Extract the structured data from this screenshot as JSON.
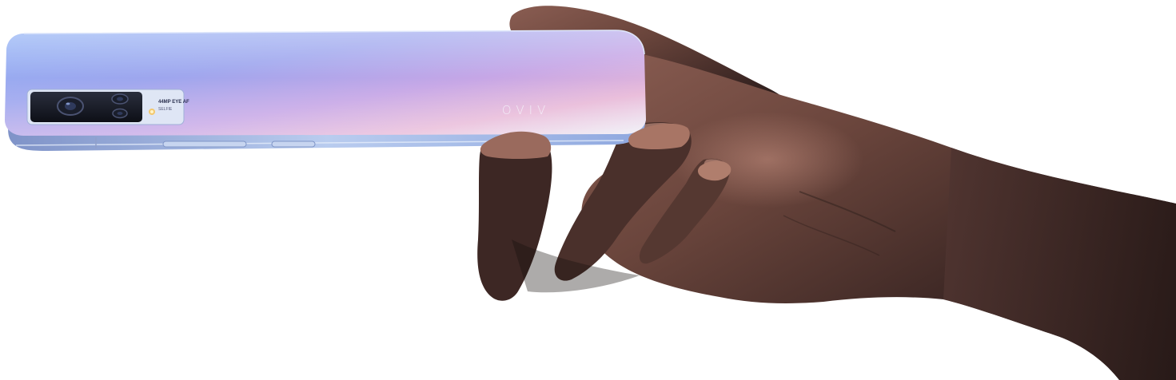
{
  "scene": {
    "background": "#ffffff",
    "phone": {
      "brand_logo": "VIVO",
      "camera_badge_title": "44MP EYE AF",
      "camera_badge_subtitle": "SELFIE",
      "gradient_colors": [
        "#6fa0ef",
        "#a79fe8",
        "#e7b6d8",
        "#e9eef7"
      ],
      "frame_color": "#a6c2ec",
      "buttons": [
        "volume-rocker",
        "power-button"
      ]
    },
    "hand": {
      "skin_base": "#5b3a33",
      "skin_shadow": "#1f1413",
      "skin_highlight": "#b58372"
    }
  }
}
